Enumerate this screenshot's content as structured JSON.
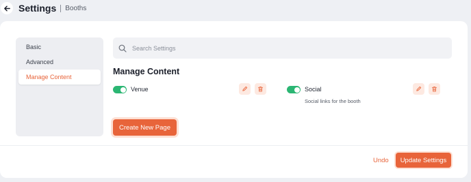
{
  "header": {
    "title": "Settings",
    "breadcrumb": "Booths"
  },
  "sidebar": {
    "items": [
      {
        "label": "Basic"
      },
      {
        "label": "Advanced"
      },
      {
        "label": "Manage Content"
      }
    ],
    "active": "Manage Content"
  },
  "search": {
    "placeholder": "Search Settings",
    "value": ""
  },
  "section": {
    "title": "Manage Content"
  },
  "content_items": [
    {
      "label": "Venue",
      "enabled": true,
      "description": ""
    },
    {
      "label": "Social",
      "enabled": true,
      "description": "Social links for the booth"
    }
  ],
  "buttons": {
    "create_new_page": "Create New Page",
    "undo": "Undo",
    "update_settings": "Update Settings"
  },
  "colors": {
    "accent": "#e8643a",
    "toggle_on": "#2bb673",
    "background": "#eef0f4"
  }
}
